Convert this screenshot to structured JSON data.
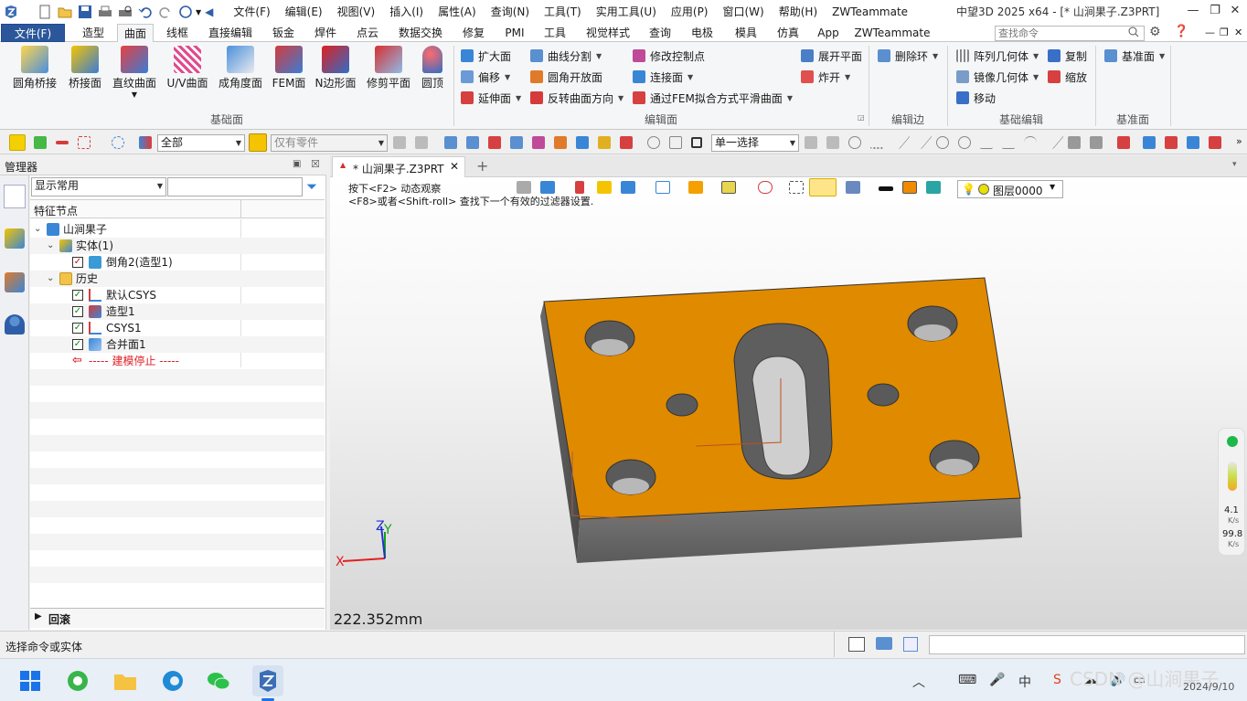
{
  "menu": {
    "items": [
      "文件(F)",
      "编辑(E)",
      "视图(V)",
      "插入(I)",
      "属性(A)",
      "查询(N)",
      "工具(T)",
      "实用工具(U)",
      "应用(P)",
      "窗口(W)",
      "帮助(H)",
      "ZWTeammate"
    ],
    "app_title": "中望3D 2025 x64 - [* 山涧果子.Z3PRT]"
  },
  "ribbon_tabs": {
    "file": "文件(F)",
    "tabs": [
      "造型",
      "曲面",
      "线框",
      "直接编辑",
      "钣金",
      "焊件",
      "点云",
      "数据交换",
      "修复",
      "PMI",
      "工具",
      "视觉样式",
      "查询",
      "电极",
      "模具",
      "仿真",
      "App",
      "ZWTeammate"
    ],
    "active": "曲面",
    "search_placeholder": "查找命令"
  },
  "ribbon": {
    "basic_surface": {
      "label": "基础面",
      "buttons": [
        "圆角桥接",
        "桥接面",
        "直纹曲面",
        "U/V曲面",
        "成角度面",
        "FEM面",
        "N边形面",
        "修剪平面",
        "圆顶"
      ]
    },
    "edit_surface": {
      "label": "编辑面",
      "col1": [
        "扩大面",
        "偏移",
        "延伸面"
      ],
      "col2": [
        "曲线分割",
        "圆角开放面",
        "反转曲面方向"
      ],
      "col3": [
        "修改控制点",
        "连接面",
        "通过FEM拟合方式平滑曲面"
      ],
      "col4": [
        "展开平面",
        "炸开"
      ]
    },
    "edit_edge": {
      "label": "编辑边",
      "button": "删除环"
    },
    "basic_edit": {
      "label": "基础编辑",
      "buttons": [
        "阵列几何体",
        "镜像几何体",
        "移动",
        "复制",
        "缩放"
      ]
    },
    "datum": {
      "label": "基准面",
      "button": "基准面"
    }
  },
  "toolbar": {
    "filter_value": "全部",
    "scope_placeholder": "仅有零件",
    "select_mode": "单一选择"
  },
  "manager": {
    "title": "管理器",
    "display_mode": "显示常用",
    "column_header": "特征节点",
    "tree": [
      {
        "label": "山涧果子",
        "level": 0
      },
      {
        "label": "实体(1)",
        "level": 1
      },
      {
        "label": "倒角2(造型1)",
        "level": 2
      },
      {
        "label": "历史",
        "level": 1
      },
      {
        "label": "默认CSYS",
        "level": 2
      },
      {
        "label": "造型1",
        "level": 2
      },
      {
        "label": "CSYS1",
        "level": 2
      },
      {
        "label": "合并面1",
        "level": 2
      },
      {
        "label": "----- 建模停止 -----",
        "level": 2
      }
    ],
    "rollback_label": "回滚"
  },
  "document": {
    "tab_label": "* 山涧果子.Z3PRT",
    "hint_line1": "按下<F2> 动态观察",
    "hint_line2": "<F8>或者<Shift-roll> 查找下一个有效的过滤器设置.",
    "layer": "图层0000",
    "scale_readout": "222.352mm",
    "axis_x": "X",
    "axis_y": "Y",
    "axis_z": "Z",
    "model_color": "#e08a00"
  },
  "perf_widget": {
    "value1": "4.1",
    "unit1": "K/s",
    "value2": "99.8",
    "unit2": "K/s"
  },
  "status": {
    "prompt": "选择命令或实体"
  },
  "taskbar": {
    "date": "2024/9/10",
    "tray_lang": "中",
    "watermark": "CSDN @山涧果子"
  }
}
